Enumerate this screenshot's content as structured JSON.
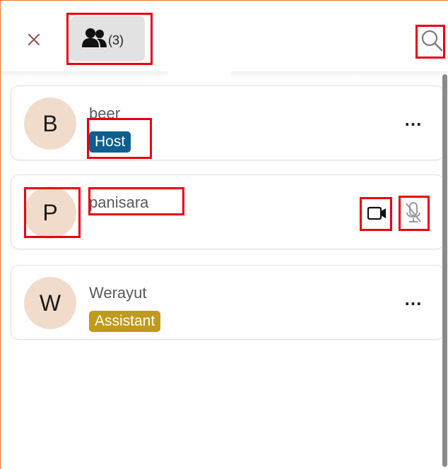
{
  "header": {
    "close_icon": "close-icon",
    "tab_participants": {
      "icon": "people-icon",
      "count": "(3)"
    },
    "search_icon": "search-icon"
  },
  "participants": [
    {
      "initial": "B",
      "name": "beer",
      "badge": "Host",
      "badge_color": "#0f5f8e",
      "action": "more-options"
    },
    {
      "initial": "P",
      "name": "panisara",
      "badge": "",
      "camera_icon": "video-camera-icon",
      "mic_icon": "microphone-muted-icon"
    },
    {
      "initial": "W",
      "name": "Werayut",
      "badge": "Assistant",
      "badge_color": "#c09a1a",
      "action": "more-options"
    }
  ],
  "more_label": "...",
  "colors": {
    "accent_border": "#e8772e",
    "highlight": "#e8000d",
    "avatar_bg": "#f1dccb",
    "tab_bg": "#e2e2e2"
  }
}
